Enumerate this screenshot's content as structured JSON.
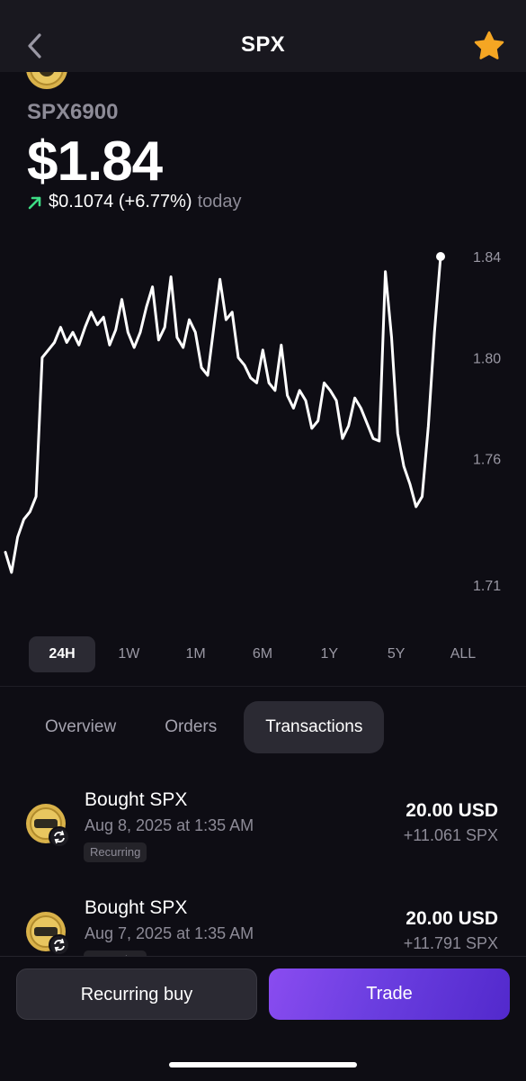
{
  "header": {
    "title": "SPX",
    "back_icon": "chevron-left-icon",
    "favorite_icon": "star-icon",
    "favorite_color": "#f5a623"
  },
  "asset": {
    "name": "SPX6900",
    "price": "$1.84",
    "change_value": "$0.1074 (+6.77%)",
    "change_period": "today",
    "change_color": "#3ddc84"
  },
  "chart_data": {
    "type": "line",
    "series": [
      {
        "values": [
          1.723,
          1.715,
          1.729,
          1.736,
          1.739,
          1.745,
          1.8,
          1.803,
          1.806,
          1.812,
          1.806,
          1.81,
          1.805,
          1.812,
          1.818,
          1.813,
          1.816,
          1.805,
          1.811,
          1.823,
          1.81,
          1.804,
          1.81,
          1.82,
          1.828,
          1.807,
          1.812,
          1.832,
          1.808,
          1.804,
          1.815,
          1.81,
          1.796,
          1.793,
          1.812,
          1.831,
          1.815,
          1.818,
          1.8,
          1.797,
          1.792,
          1.79,
          1.803,
          1.79,
          1.787,
          1.805,
          1.785,
          1.78,
          1.787,
          1.783,
          1.772,
          1.775,
          1.79,
          1.787,
          1.783,
          1.768,
          1.773,
          1.784,
          1.78,
          1.774,
          1.768,
          1.767,
          1.834,
          1.808,
          1.77,
          1.757,
          1.75,
          1.741,
          1.745,
          1.773,
          1.81,
          1.84
        ]
      }
    ],
    "y_ticks": [
      "1.84",
      "1.80",
      "1.76",
      "1.71"
    ],
    "ylim": [
      1.71,
      1.84
    ],
    "line_color": "#ffffff",
    "end_marker": true
  },
  "ranges": {
    "active": "24H",
    "items": [
      "24H",
      "1W",
      "1M",
      "6M",
      "1Y",
      "5Y",
      "ALL"
    ]
  },
  "tabs": {
    "active": "Transactions",
    "items": [
      "Overview",
      "Orders",
      "Transactions"
    ]
  },
  "transactions": [
    {
      "title": "Bought SPX",
      "date": "Aug 8, 2025 at 1:35 AM",
      "badge": "Recurring",
      "amount": "20.00 USD",
      "quantity": "+11.061 SPX"
    },
    {
      "title": "Bought SPX",
      "date": "Aug 7, 2025 at 1:35 AM",
      "badge": "Recurring",
      "amount": "20.00 USD",
      "quantity": "+11.791 SPX"
    }
  ],
  "actions": {
    "recurring_buy": "Recurring buy",
    "trade": "Trade"
  }
}
